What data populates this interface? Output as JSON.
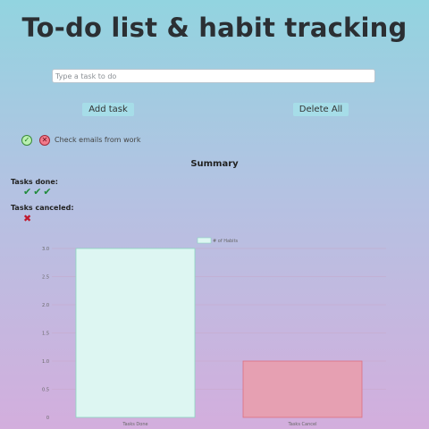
{
  "title": "To-do list & habit tracking",
  "task_input": {
    "placeholder": "Type a task to do",
    "value": ""
  },
  "buttons": {
    "add": "Add task",
    "delete_all": "Delete All"
  },
  "task": {
    "text": "Check emails from work",
    "done_icon": "check-icon",
    "cancel_icon": "x-icon"
  },
  "summary": {
    "title": "Summary",
    "done_label": "Tasks done:",
    "done_marks": "✔✔✔",
    "canceled_label": "Tasks canceled:",
    "canceled_marks": "✖"
  },
  "colors": {
    "done_bar_fill": "#ddf6f2",
    "done_bar_stroke": "#8ad6c0",
    "canceled_bar_fill": "#e6a0b2",
    "canceled_bar_stroke": "#dd7080",
    "done_mark": "#1f8a3a",
    "canceled_mark": "#c0182e"
  },
  "chart_data": {
    "type": "bar",
    "categories": [
      "Tasks Done",
      "Tasks Cancel"
    ],
    "values": [
      3,
      1
    ],
    "legend": "# of Habits",
    "ylim": [
      0,
      3
    ],
    "yticks": [
      "0",
      "0.5",
      "1.0",
      "1.5",
      "2.0",
      "2.5",
      "3.0"
    ],
    "ytick_values": [
      0,
      0.5,
      1,
      1.5,
      2,
      2.5,
      3
    ],
    "grid": true,
    "legend_position": "top-center"
  }
}
